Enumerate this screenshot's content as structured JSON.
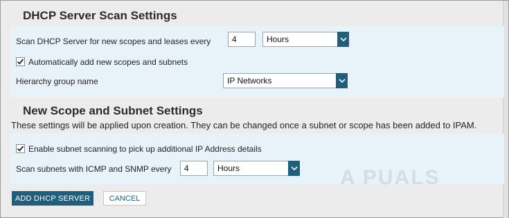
{
  "dhcp_scan": {
    "title": "DHCP Server Scan Settings",
    "scan_label": "Scan DHCP Server for new scopes and leases every",
    "scan_interval_value": "4",
    "scan_unit_selected": "Hours",
    "auto_add_label": "Automatically add new scopes and subnets",
    "auto_add_checked": true,
    "hierarchy_label": "Hierarchy group name",
    "hierarchy_selected": "IP Networks"
  },
  "scope_settings": {
    "title": "New Scope and Subnet Settings",
    "description": "These settings will be applied upon creation. They can be changed once a subnet or scope has been added to IPAM.",
    "enable_scan_label": "Enable subnet scanning to pick up additional IP Address details",
    "enable_scan_checked": true,
    "icmp_label": "Scan subnets with ICMP and SNMP every",
    "icmp_interval_value": "4",
    "icmp_unit_selected": "Hours"
  },
  "actions": {
    "add_label": "ADD DHCP SERVER",
    "cancel_label": "CANCEL"
  },
  "watermark": "A PUALS",
  "colors": {
    "accent": "#1f5f7d",
    "panel": "#e8f3f9",
    "background": "#ececec"
  }
}
